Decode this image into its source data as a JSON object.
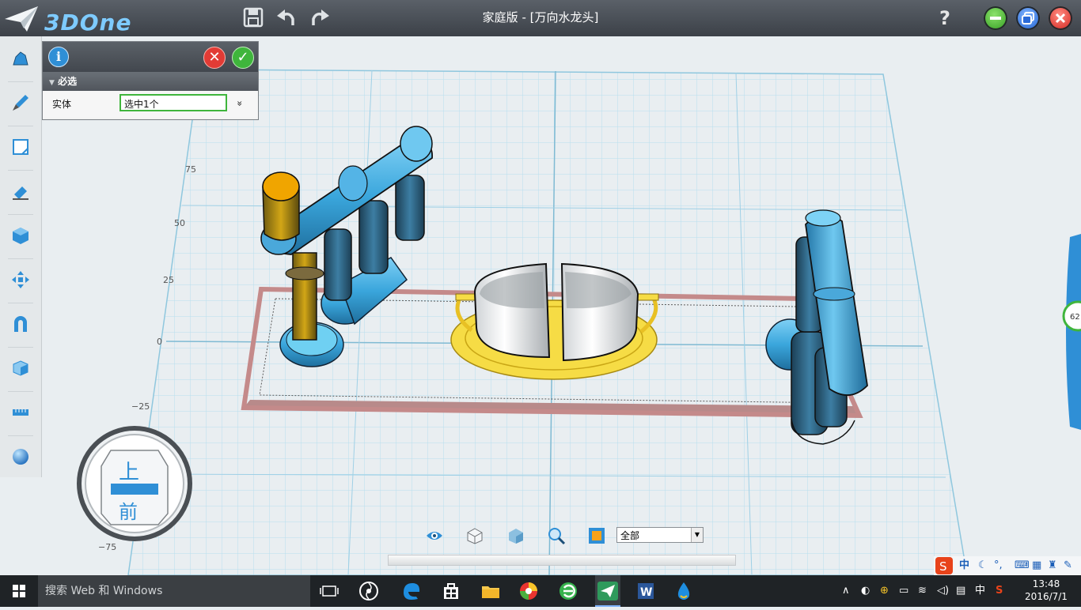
{
  "app": {
    "logo_text": "3DOne",
    "title": "家庭版 - [万向水龙头]",
    "help_label": "?"
  },
  "icons": {
    "logo": "paper-plane-icon",
    "save": "save-icon",
    "undo": "undo-icon",
    "redo": "redo-icon",
    "minimize": "minimize-icon",
    "restore": "restore-icon",
    "close": "close-icon"
  },
  "colors": {
    "accent_blue": "#2f8fd6",
    "ok_green": "#3fb53c",
    "cancel_red": "#e23b35",
    "grid_line": "#9fd0e6",
    "model_blue": "#3aa6dc",
    "model_yellow": "#f0c419"
  },
  "panel": {
    "info_label": "i",
    "cancel_label": "✕",
    "ok_label": "✓",
    "section_label": "必选",
    "field_label": "实体",
    "field_value": "选中1个",
    "expand_label": "»"
  },
  "sidebar": {
    "items": [
      {
        "name": "shape-tool",
        "icon": "cloud-shape-icon"
      },
      {
        "name": "sketch-tool",
        "icon": "brush-icon"
      },
      {
        "name": "edit-sketch-tool",
        "icon": "sketch-square-icon"
      },
      {
        "name": "feature-tool",
        "icon": "eraser-icon"
      },
      {
        "name": "special-tool",
        "icon": "cube-icon"
      },
      {
        "name": "transform-tool",
        "icon": "move-arrows-icon"
      },
      {
        "name": "combine-tool",
        "icon": "magnet-icon"
      },
      {
        "name": "array-tool",
        "icon": "stacked-cube-icon"
      },
      {
        "name": "distance-tool",
        "icon": "ruler-icon"
      },
      {
        "name": "material-tool",
        "icon": "sphere-icon"
      }
    ]
  },
  "viewport": {
    "axis_labels": [
      "75",
      "50",
      "25",
      "0",
      "−25",
      "−75"
    ],
    "view_cube_top": "上",
    "view_cube_front": "前",
    "side_badge": "62"
  },
  "bottom_tools": {
    "icons": [
      "eye-icon",
      "wire-cube-icon",
      "solid-cube-icon",
      "zoom-icon",
      "render-icon"
    ],
    "filter_value": "全部"
  },
  "ime": {
    "lang": "中",
    "icons": [
      "moon-icon",
      "punct-icon",
      "keyboard-icon",
      "grid-icon",
      "shirt-icon",
      "wrench-icon"
    ]
  },
  "taskbar": {
    "search_placeholder": "搜索 Web 和 Windows",
    "tray_lang": "中",
    "time": "13:48",
    "date": "2016/7/1"
  }
}
